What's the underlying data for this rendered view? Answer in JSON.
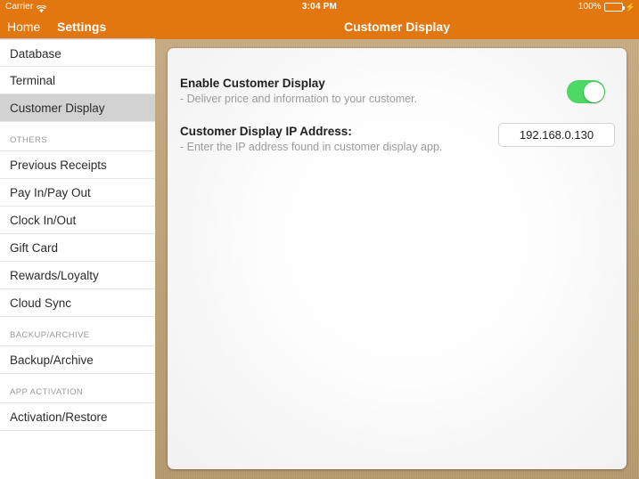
{
  "status_bar": {
    "carrier": "Carrier",
    "wifi_icon": "wifi-icon",
    "time": "3:04 PM",
    "battery_percent": "100%",
    "battery_icon": "battery-full-icon",
    "charging_icon": "lightning-bolt-icon"
  },
  "nav": {
    "home_label": "Home",
    "settings_label": "Settings",
    "title": "Customer Display",
    "bar_color": "#e2760f"
  },
  "sidebar": {
    "groups": [
      {
        "header": null,
        "items": [
          {
            "label": "Database",
            "selected": false
          },
          {
            "label": "Terminal",
            "selected": false
          },
          {
            "label": "Customer Display",
            "selected": true
          }
        ]
      },
      {
        "header": "OTHERS",
        "items": [
          {
            "label": "Previous Receipts",
            "selected": false
          },
          {
            "label": "Pay In/Pay Out",
            "selected": false
          },
          {
            "label": "Clock In/Out",
            "selected": false
          },
          {
            "label": "Gift Card",
            "selected": false
          },
          {
            "label": "Rewards/Loyalty",
            "selected": false
          },
          {
            "label": "Cloud Sync",
            "selected": false
          }
        ]
      },
      {
        "header": "BACKUP/ARCHIVE",
        "items": [
          {
            "label": "Backup/Archive",
            "selected": false
          }
        ]
      },
      {
        "header": "APP ACTIVATION",
        "items": [
          {
            "label": "Activation/Restore",
            "selected": false
          }
        ]
      }
    ],
    "selected_background": "#d2d2d2"
  },
  "detail": {
    "backdrop_color": "#c0a172",
    "rows": [
      {
        "title": "Enable Customer Display",
        "subtitle": "- Deliver price and information to your customer.",
        "control": "toggle",
        "toggle_on": true,
        "toggle_on_color": "#4cd964"
      },
      {
        "title": "Customer Display IP Address:",
        "subtitle": "- Enter the IP address found in customer display app.",
        "control": "textfield",
        "value": "192.168.0.130",
        "placeholder": "IP Address"
      }
    ]
  }
}
